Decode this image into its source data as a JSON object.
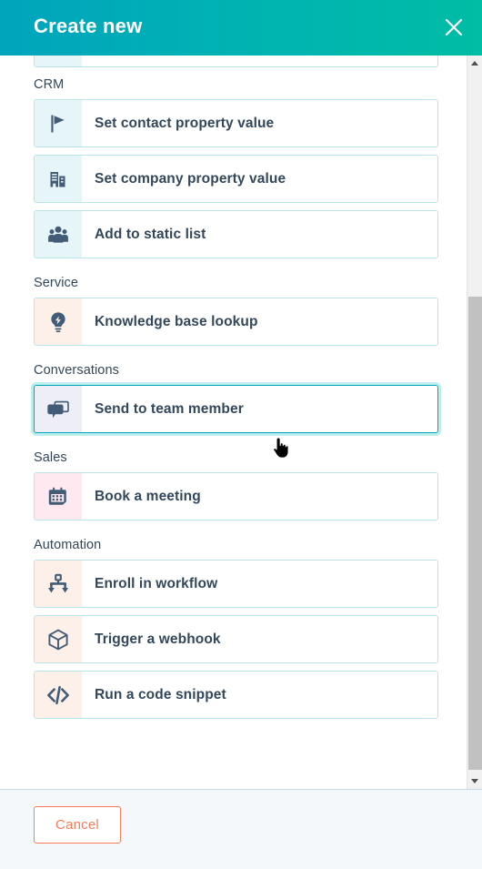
{
  "header": {
    "title": "Create new",
    "close_icon": "close-icon",
    "gradient_from": "#00A4BD",
    "gradient_to": "#00BDA5"
  },
  "sections": [
    {
      "label": "",
      "partial": true,
      "items": [
        {
          "label": "",
          "icon": "partial-icon",
          "icon_bg": "bg-cyan",
          "hovered": false
        }
      ]
    },
    {
      "label": "CRM",
      "partial": false,
      "items": [
        {
          "label": "Set contact property value",
          "icon": "flag-icon",
          "icon_bg": "bg-cyan",
          "hovered": false
        },
        {
          "label": "Set company property value",
          "icon": "company-icon",
          "icon_bg": "bg-cyan",
          "hovered": false
        },
        {
          "label": "Add to static list",
          "icon": "contacts-group-icon",
          "icon_bg": "bg-cyan",
          "hovered": false
        }
      ]
    },
    {
      "label": "Service",
      "partial": false,
      "items": [
        {
          "label": "Knowledge base lookup",
          "icon": "lightbulb-icon",
          "icon_bg": "bg-peach",
          "hovered": false
        }
      ]
    },
    {
      "label": "Conversations",
      "partial": false,
      "items": [
        {
          "label": "Send to team member",
          "icon": "chat-bubbles-icon",
          "icon_bg": "bg-lavender",
          "hovered": true
        }
      ]
    },
    {
      "label": "Sales",
      "partial": false,
      "items": [
        {
          "label": "Book a meeting",
          "icon": "calendar-icon",
          "icon_bg": "bg-pink",
          "hovered": false
        }
      ]
    },
    {
      "label": "Automation",
      "partial": false,
      "items": [
        {
          "label": "Enroll in workflow",
          "icon": "workflow-icon",
          "icon_bg": "bg-peach",
          "hovered": false
        },
        {
          "label": "Trigger a webhook",
          "icon": "cube-icon",
          "icon_bg": "bg-peach",
          "hovered": false
        },
        {
          "label": "Run a code snippet",
          "icon": "code-icon",
          "icon_bg": "bg-peach",
          "hovered": false
        }
      ]
    }
  ],
  "footer": {
    "cancel_label": "Cancel",
    "cancel_color": "#FF7A59"
  },
  "scrollbar": {
    "up_icon": "scroll-up-arrow-icon",
    "down_icon": "scroll-down-arrow-icon"
  },
  "cursor": {
    "type": "pointer-hand-cursor"
  },
  "colors": {
    "icon_fill": "#425B76",
    "text": "#33475B",
    "card_border": "#B9E4E8"
  }
}
